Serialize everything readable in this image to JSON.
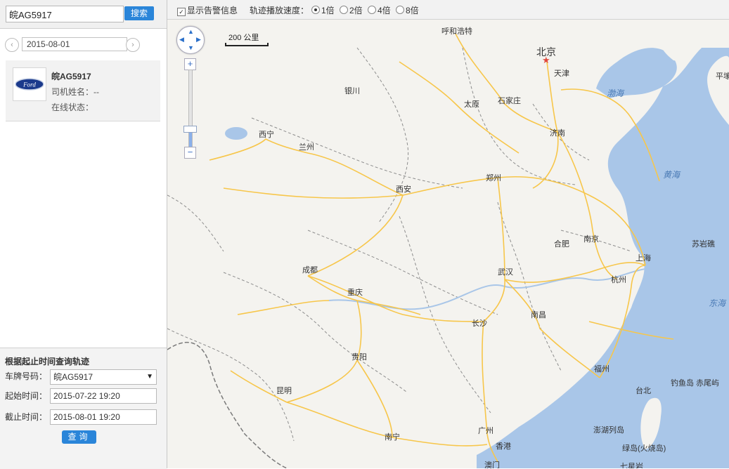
{
  "search": {
    "value": "皖AG5917",
    "button": "搜索"
  },
  "date_nav": {
    "date": "2015-08-01",
    "prev": "‹",
    "next": "›"
  },
  "vehicle": {
    "plate": "皖AG5917",
    "driver_label": "司机姓名：--",
    "status_label": "在线状态：",
    "logo": "Ford"
  },
  "query": {
    "title": "根据起止时间查询轨迹",
    "plate_label": "车牌号码：",
    "plate_value": "皖AG5917",
    "start_label": "起始时间：",
    "start_value": "2015-07-22 19:20",
    "end_label": "截止时间：",
    "end_value": "2015-08-01 19:20",
    "button": "查询"
  },
  "toolbar": {
    "alarm_label": "显示告警信息",
    "alarm_checked": true,
    "speed_label": "轨迹播放速度：",
    "speeds": [
      "1倍",
      "2倍",
      "4倍",
      "8倍"
    ],
    "selected_speed": "1倍"
  },
  "map": {
    "scale": "200 公里",
    "capital": "北京",
    "cities": [
      "呼和浩特",
      "北京",
      "天津",
      "银川",
      "太原",
      "石家庄",
      "西宁",
      "兰州",
      "济南",
      "西安",
      "郑州",
      "合肥",
      "南京",
      "上海",
      "成都",
      "武汉",
      "杭州",
      "重庆",
      "长沙",
      "南昌",
      "贵阳",
      "福州",
      "昆明",
      "台北",
      "南宁",
      "广州",
      "香港",
      "澳门",
      "平壤"
    ],
    "seas": [
      "渤海",
      "黄海",
      "东海"
    ],
    "islands": [
      "苏岩礁",
      "钓鱼岛",
      "赤尾屿",
      "澎湖列岛",
      "绿岛(火烧岛)",
      "七星岩"
    ],
    "colors": {
      "land": "#f4f3ef",
      "water": "#a9c6e8",
      "highway": "#f7c64a",
      "border": "#8d8d8d",
      "city_dot": "#e0483b"
    }
  }
}
